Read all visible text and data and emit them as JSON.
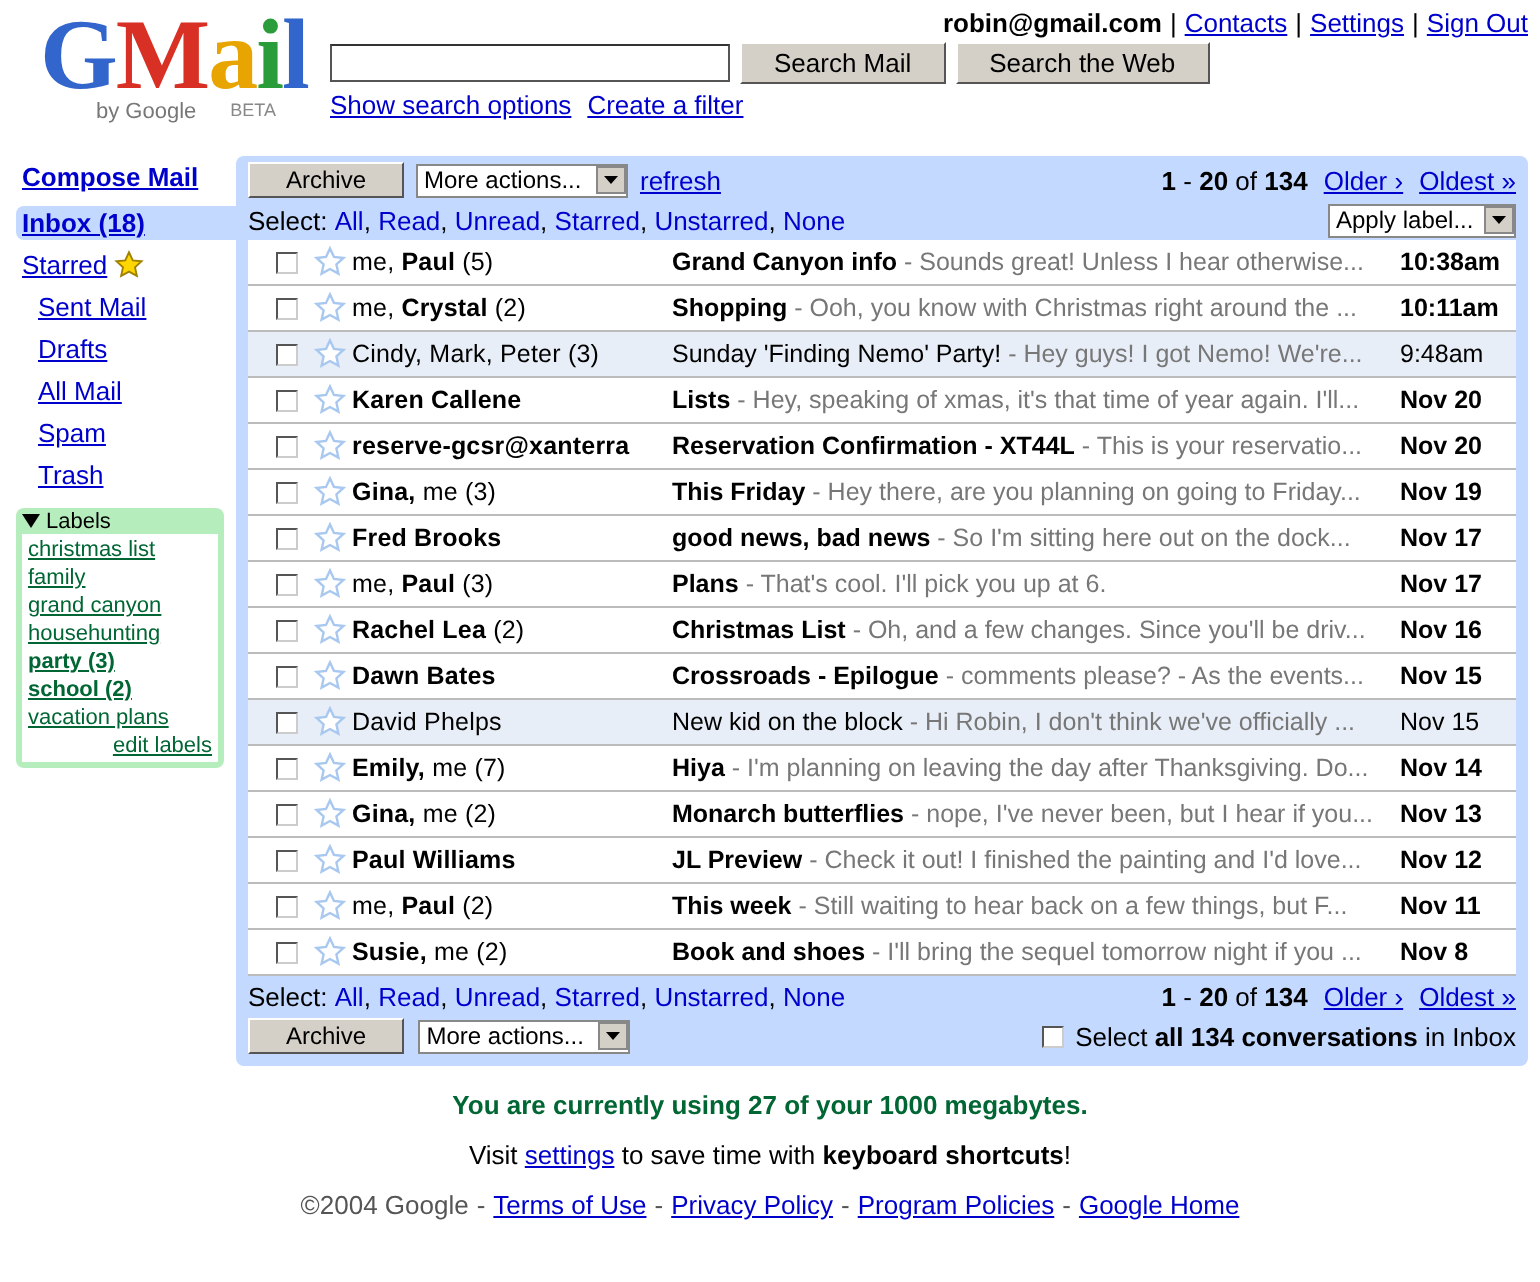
{
  "logo": {
    "letters": [
      "G",
      "M",
      "a",
      "i",
      "l"
    ],
    "byline": "by Google",
    "badge": "BETA"
  },
  "account": {
    "email": "robin@gmail.com",
    "separator": "|",
    "links": [
      "Contacts",
      "Settings",
      "Sign Out"
    ]
  },
  "search": {
    "buttons": [
      "Search Mail",
      "Search the Web"
    ],
    "links": [
      "Show search options",
      "Create a filter"
    ]
  },
  "sidebar": {
    "compose": "Compose Mail",
    "items": [
      {
        "label": "Inbox (18)",
        "selected": true,
        "starred": false
      },
      {
        "label": "Starred",
        "selected": false,
        "starred": true
      },
      {
        "label": "Sent Mail",
        "selected": false,
        "starred": false
      },
      {
        "label": "Drafts",
        "selected": false,
        "starred": false
      },
      {
        "label": "All Mail",
        "selected": false,
        "starred": false
      },
      {
        "label": "Spam",
        "selected": false,
        "starred": false
      },
      {
        "label": "Trash",
        "selected": false,
        "starred": false
      }
    ],
    "labels": {
      "title": "Labels",
      "expanded": true,
      "items": [
        {
          "label": "christmas list",
          "unread": false
        },
        {
          "label": "family",
          "unread": false
        },
        {
          "label": "grand canyon",
          "unread": false
        },
        {
          "label": "househunting",
          "unread": false
        },
        {
          "label": "party (3)",
          "unread": true
        },
        {
          "label": "school (2)",
          "unread": true
        },
        {
          "label": "vacation plans",
          "unread": false
        }
      ],
      "edit": "edit labels"
    }
  },
  "toolbar_top": {
    "archive": "Archive",
    "actions": "More actions...",
    "refresh": "refresh",
    "apply_label": "Apply label..."
  },
  "select": {
    "label": "Select:",
    "separator": ",",
    "options": [
      "All",
      "Read",
      "Unread",
      "Starred",
      "Unstarred",
      "None"
    ]
  },
  "pagination": {
    "count": "**1** - **20** of **134**",
    "older": "Older ›",
    "oldest": "Oldest »"
  },
  "rows": [
    {
      "sender": "me, **Paul** (5)",
      "subject": "Grand Canyon info",
      "snippet": "- Sounds great! Unless I hear otherwise...",
      "date": "10:38am",
      "unread": true,
      "checked": false,
      "starred": false
    },
    {
      "sender": "me, **Crystal** (2)",
      "subject": "Shopping",
      "snippet": "- Ooh, you know with Christmas right around the ...",
      "date": "10:11am",
      "unread": true,
      "checked": false,
      "starred": false
    },
    {
      "sender": "Cindy, Mark, Peter (3)",
      "subject": "Sunday 'Finding Nemo' Party!",
      "snippet": "- Hey guys! I got Nemo! We're...",
      "date": "9:48am",
      "unread": false,
      "checked": false,
      "starred": false
    },
    {
      "sender": "**Karen Callene**",
      "subject": "Lists",
      "snippet": "- Hey, speaking of xmas, it's that time of year again. I'll...",
      "date": "Nov 20",
      "unread": true,
      "checked": false,
      "starred": false
    },
    {
      "sender": "**reserve-gcsr@xanterra**",
      "subject": "Reservation Confirmation - XT44L",
      "snippet": "- This is your reservatio...",
      "date": "Nov 20",
      "unread": true,
      "checked": false,
      "starred": false
    },
    {
      "sender": "**Gina,** me (3)",
      "subject": "This Friday",
      "snippet": "- Hey there, are you planning on going to Friday...",
      "date": "Nov 19",
      "unread": true,
      "checked": false,
      "starred": false
    },
    {
      "sender": "**Fred Brooks**",
      "subject": "good news, bad news",
      "snippet": "- So I'm sitting here out on the dock...",
      "date": "Nov 17",
      "unread": true,
      "checked": false,
      "starred": false
    },
    {
      "sender": "me, **Paul** (3)",
      "subject": "Plans",
      "snippet": "- That's cool. I'll pick you up at 6.",
      "date": "Nov 17",
      "unread": true,
      "checked": false,
      "starred": false
    },
    {
      "sender": "**Rachel Lea** (2)",
      "subject": "Christmas List",
      "snippet": "- Oh, and a few changes. Since you'll be driv...",
      "date": "Nov 16",
      "unread": true,
      "checked": false,
      "starred": false
    },
    {
      "sender": "**Dawn Bates**",
      "subject": "Crossroads - Epilogue",
      "snippet": "- comments please? - As the events...",
      "date": "Nov 15",
      "unread": true,
      "checked": false,
      "starred": false
    },
    {
      "sender": "David Phelps",
      "subject": "New kid on the block",
      "snippet": "- Hi Robin, I don't think we've officially ...",
      "date": "Nov 15",
      "unread": false,
      "checked": false,
      "starred": false
    },
    {
      "sender": "**Emily,** me (7)",
      "subject": "Hiya",
      "snippet": "- I'm planning on leaving the day after Thanksgiving. Do...",
      "date": "Nov 14",
      "unread": true,
      "checked": false,
      "starred": false
    },
    {
      "sender": "**Gina,** me (2)",
      "subject": "Monarch butterflies",
      "snippet": "- nope, I've never been, but I hear if you...",
      "date": "Nov 13",
      "unread": true,
      "checked": false,
      "starred": false
    },
    {
      "sender": "**Paul Williams**",
      "subject": "JL Preview",
      "snippet": "- Check it out! I finished the painting and I'd love...",
      "date": "Nov 12",
      "unread": true,
      "checked": false,
      "starred": false
    },
    {
      "sender": "me, **Paul** (2)",
      "subject": "This week",
      "snippet": "- Still waiting to hear back on a few things, but F...",
      "date": "Nov 11",
      "unread": true,
      "checked": false,
      "starred": false
    },
    {
      "sender": "**Susie,** me (2)",
      "subject": "Book and shoes",
      "snippet": "- I'll bring the sequel tomorrow night if you ...",
      "date": "Nov 8",
      "unread": true,
      "checked": false,
      "starred": false
    }
  ],
  "select_bottom": {
    "label": "Select:",
    "separator": ",",
    "options": [
      "All",
      "Read",
      "Unread",
      "Starred",
      "Unstarred",
      "None"
    ]
  },
  "pagination_bottom": {
    "count": "**1** - **20** of **134**",
    "older": "Older ›",
    "oldest": "Oldest »"
  },
  "toolbar_bottom": {
    "archive": "Archive",
    "actions": "More actions...",
    "select_all": {
      "text": "Select **all 134 conversations** in Inbox",
      "checked": false
    }
  },
  "footer": {
    "usage": "You are currently using 27 of your 1000 megabytes.",
    "tip": {
      "before": "Visit",
      "link": "settings",
      "after": "to save time with **keyboard shortcuts**!"
    },
    "copyright": "©2004 Google",
    "separator": "-",
    "links": [
      "Terms of Use",
      "Privacy Policy",
      "Program Policies",
      "Google Home"
    ]
  }
}
